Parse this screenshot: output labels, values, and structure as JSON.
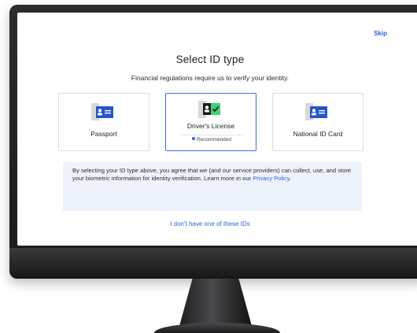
{
  "header": {
    "skip_label": "Skip"
  },
  "main": {
    "title": "Select ID type",
    "subtitle": "Financial regulations require us to verify your identity."
  },
  "id_types": [
    {
      "label": "Passport",
      "icon": "passport-icon",
      "selected": false
    },
    {
      "label": "Driver's License",
      "icon": "drivers-license-icon",
      "selected": true,
      "badge": "Recommended"
    },
    {
      "label": "National ID Card",
      "icon": "national-id-icon",
      "selected": false
    }
  ],
  "consent": {
    "text": "By selecting your ID type above, you agree that we (and our service providers) can collect, use, and store your biometric information for identity verification. Learn more in our",
    "link_label": "Privacy Policy",
    "end": "."
  },
  "footer": {
    "no_id_label": "I don't have one of these IDs"
  },
  "colors": {
    "accent": "#2f64d8",
    "consent_bg": "#eef2fb",
    "card_selected_border": "#3d6fe0",
    "check_green": "#3fcf7a"
  }
}
